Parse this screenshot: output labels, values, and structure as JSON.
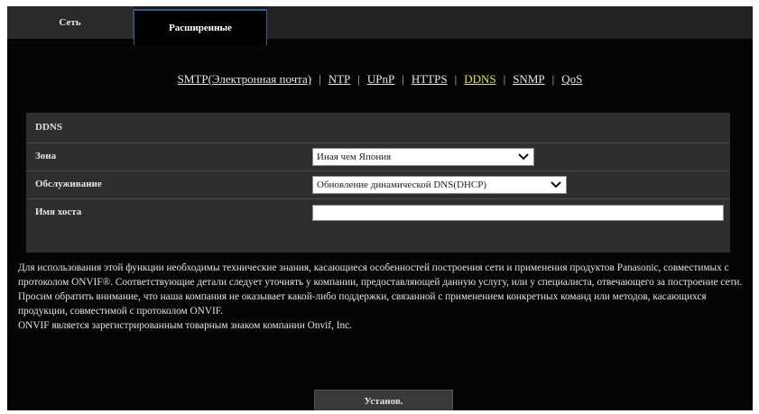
{
  "tabs": {
    "network": "Сеть",
    "extended": "Расширенные"
  },
  "subnav": [
    "SMTP(Электронная почта)",
    "NTP",
    "UPnP",
    "HTTPS",
    "DDNS",
    "SNMP",
    "QoS"
  ],
  "subnav_active": "DDNS",
  "panel": {
    "title": "DDNS",
    "zone_label": "Зона",
    "zone_value": "Иная чем Япония",
    "service_label": "Обслуживание",
    "service_value": "Обновление динамической DNS(DHCP)",
    "host_label": "Имя хоста",
    "host_value": ""
  },
  "info": [
    "Для использования этой функции необходимы технические знания, касающиеся особенностей построения сети и применения продуктов Panasonic, совместимых с протоколом ONVIF®. Соответствующие детали следует уточнять у компании, предоставляющей данную услугу, или у специалиста, отвечающего за построение сети.",
    "Просим обратить внимание, что наша компания не оказывает какой-либо поддержки, связанной с применением конкретных команд или методов, касающихся продукции, совместимой с протоколом ONVIF.",
    "ONVIF является зарегистрированным товарным знаком компании Onvif, Inc."
  ],
  "submit_label": "Установ.",
  "colors": {
    "active_link": "#e5e32e",
    "tab_accent": "#2f5f97",
    "panel_bg": "#2e2e2e"
  }
}
